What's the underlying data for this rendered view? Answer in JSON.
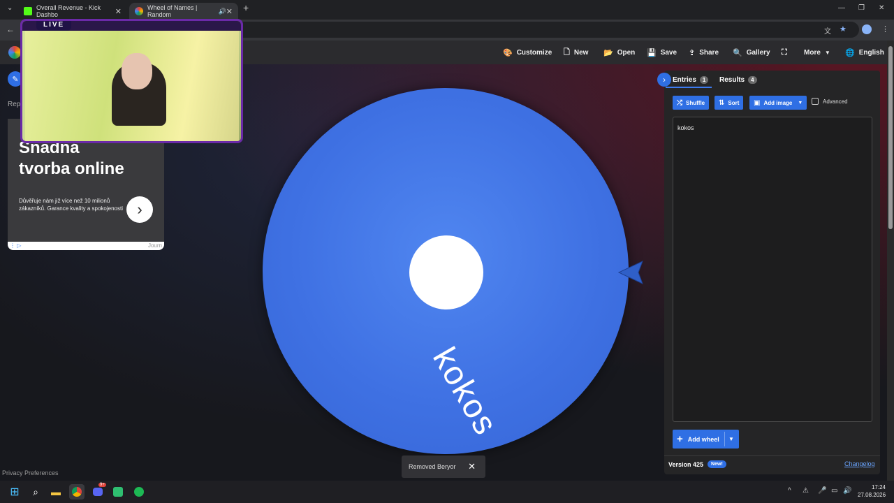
{
  "browser": {
    "tabs": [
      {
        "title": "Overall Revenue - Kick Dashbo",
        "close": "✕",
        "fav_color": "#53fc18"
      },
      {
        "title": "Wheel of Names | Random",
        "close": "✕",
        "fav_color": "#e0443b"
      }
    ],
    "new_tab": "+",
    "controls": {
      "minimize": "—",
      "restore": "❐",
      "close": "✕"
    }
  },
  "overlay": {
    "live_text": "LIVE"
  },
  "header": {
    "customize": "Customize",
    "new": "New",
    "open": "Open",
    "save": "Save",
    "share": "Share",
    "gallery": "Gallery",
    "more": "More",
    "language": "English"
  },
  "left": {
    "rep_text": "Rep"
  },
  "ad": {
    "line1": "Snadná",
    "line2": "tvorba online",
    "body": "Důvěřuje nám již více než 10 milionů zákazníků. Garance kvality a spokojenosti",
    "arrow": "›",
    "footer": "Journ"
  },
  "wheel": {
    "entry_label": "kokos",
    "color": "#3f71e3"
  },
  "panel": {
    "tab_entries": "Entries",
    "entries_count": "1",
    "tab_results": "Results",
    "results_count": "4",
    "shuffle": "Shuffle",
    "sort": "Sort",
    "add_image": "Add image",
    "advanced": "Advanced",
    "entries_text": "kokos",
    "add_wheel": "Add wheel",
    "version": "Version 425",
    "new_badge": "New!",
    "changelog": "Changelog"
  },
  "toast": {
    "message": "Removed Beryor",
    "close": "✕"
  },
  "footer": {
    "privacy": "Privacy Preferences"
  },
  "taskbar": {
    "time": "17:24",
    "date": "27.08.2026",
    "discord_badge": "9+"
  }
}
